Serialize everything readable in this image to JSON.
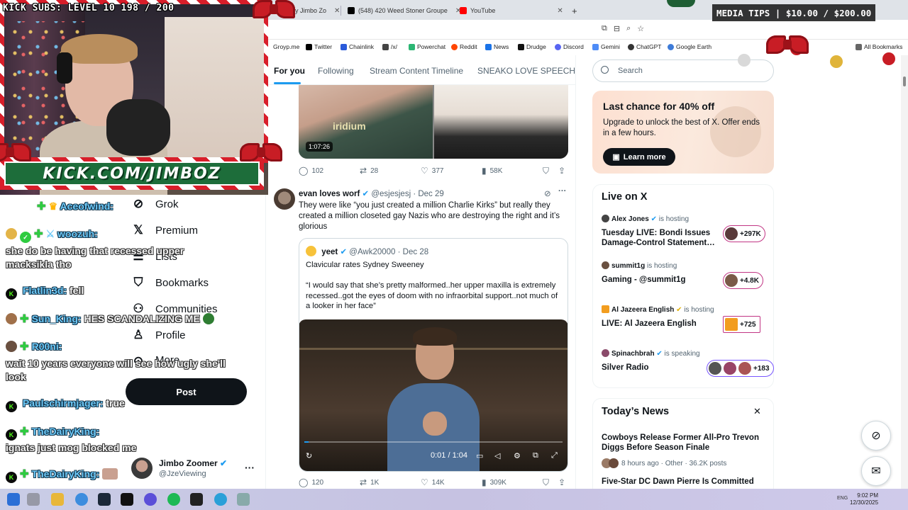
{
  "browser": {
    "tabs": [
      {
        "label": "by Jimbo Zo"
      },
      {
        "label": "(548) 420 Weed Stoner Groupe"
      },
      {
        "label": "YouTube"
      }
    ],
    "bookmarks": [
      "Groyp.me",
      "Twitter",
      "Chainlink",
      "/x/",
      "Powerchat",
      "Reddit",
      "News",
      "Drudge",
      "Discord",
      "Gemini",
      "ChatGPT",
      "Google Earth",
      "All Bookmarks"
    ]
  },
  "overlay": {
    "kick_subs": "KICK SUBS: LEVEL 10 198 / 200",
    "banner": "KICK.COM/JIMBOZ",
    "media_tips": "MEDIA TIPS | $10.00 / $200.00"
  },
  "chat": [
    {
      "user": "Aceofwind:",
      "msg": ""
    },
    {
      "user": "woozuh:",
      "msg": ""
    },
    {
      "user": "",
      "msg": "she do be having that recessed upper macksikla tho"
    },
    {
      "user": "Flatlin3d:",
      "msg": "fell"
    },
    {
      "user": "Sun_King:",
      "msg": "HES SCANDALIZING ME"
    },
    {
      "user": "R00ni:",
      "msg": ""
    },
    {
      "user": "",
      "msg": "wait 10 years everyone will see how ugly she'll look"
    },
    {
      "user": "Paulschirmjager:",
      "msg": "true"
    },
    {
      "user": "TheDairyKing:",
      "msg": ""
    },
    {
      "user": "",
      "msg": "ignats just mog blocked me"
    },
    {
      "user": "TheDairyKing:",
      "msg": ""
    }
  ],
  "nav": {
    "items": [
      "Grok",
      "Premium",
      "Lists",
      "Bookmarks",
      "Communities",
      "Profile",
      "More"
    ],
    "post": "Post"
  },
  "account": {
    "name": "Jimbo Zoomer",
    "handle": "@JzeViewing"
  },
  "feed": {
    "tabs": [
      "For you",
      "Following",
      "Stream Content Timeline",
      "SNEAKO LOVE SPEECH"
    ],
    "top_media": {
      "duration": "1:07:26",
      "brand": "iridium"
    },
    "top_actions": {
      "replies": "102",
      "reposts": "28",
      "likes": "377",
      "views": "58K"
    },
    "tweet": {
      "name": "evan loves worf",
      "handle": "@esjesjesj",
      "date": "· Dec 29",
      "text": "They were like “you just created a million Charlie Kirks” but really they created a million closeted gay Nazis who are destroying the right and it’s glorious",
      "quote": {
        "name": "yeet",
        "handle": "@Awk20000",
        "date": "· Dec 28",
        "text": "Clavicular rates Sydney Sweeney\n\n“I would say that she’s pretty malformed..her upper maxilla is extremely recessed..got the eyes of doom with no infraorbital support..not much of a looker in her face”",
        "video_time": "0:01 / 1:04",
        "video_progress": 0.016
      },
      "actions": {
        "replies": "120",
        "reposts": "1K",
        "likes": "14K",
        "views": "309K"
      }
    }
  },
  "right": {
    "search_placeholder": "Search",
    "promo": {
      "title": "Last chance for 40% off",
      "desc": "Upgrade to unlock the best of X. Offer ends in a few hours.",
      "button": "Learn more"
    },
    "live": {
      "heading": "Live on X",
      "items": [
        {
          "host": "Alex Jones",
          "status": "is hosting",
          "title": "Tuesday LIVE: Bondi Issues Damage-Control Statement…",
          "count": "+297K"
        },
        {
          "host": "summit1g",
          "status": "is hosting",
          "title": "Gaming - @summit1g",
          "count": "+4.8K"
        },
        {
          "host": "Al Jazeera English",
          "status": "is hosting",
          "title": "LIVE: Al Jazeera English",
          "count": "+725"
        },
        {
          "host": "Spinachbrah",
          "status": "is speaking",
          "title": "Silver Radio",
          "count": "+183"
        }
      ]
    },
    "news": {
      "heading": "Today’s News",
      "headline": "Cowboys Release Former All-Pro Trevon Diggs Before Season Finale",
      "meta": "8 hours ago · Other · 36.2K posts",
      "next": "Five-Star DC Dawn Pierre Is Committed"
    }
  },
  "taskbar": {
    "lang": "ENG",
    "time": "9:02 PM",
    "date": "12/30/2025"
  },
  "colors": {
    "accent": "#1d9bf0",
    "kick_green": "#53fc18",
    "candy_red": "#d81e2a",
    "live_pink": "#c13584"
  }
}
